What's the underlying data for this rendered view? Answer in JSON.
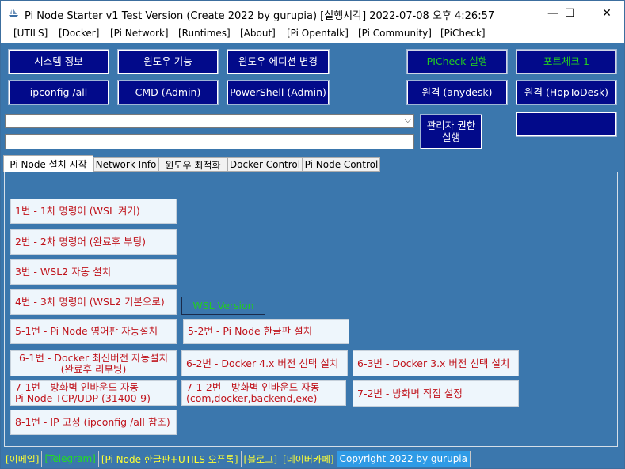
{
  "window": {
    "title": "Pi Node Starter v1 Test Version (Create 2022 by gurupia) [실행시각] 2022-07-08 오후 4:26:57",
    "controls": {
      "minimize": "—",
      "maximize": "☐",
      "close": "✕"
    }
  },
  "menu": [
    "[UTILS]",
    "[Docker]",
    "[Pi Network]",
    "[Runtimes]",
    "[About]",
    "[Pi Opentalk]",
    "[Pi Community]",
    "[PiCheck]"
  ],
  "toolbar": {
    "system_info": "시스템 정보",
    "windows_features": "윈도우 기능",
    "change_edition": "윈도우 에디션 변경",
    "picheck_run": "PICheck 실행",
    "port_check": "포트체크 1",
    "ipconfig": "ipconfig /all",
    "cmd_admin": "CMD (Admin)",
    "powershell_admin": "PowerShell (Admin)",
    "remote_anydesk": "원격 (anydesk)",
    "remote_hoptodesk": "원격 (HopToDesk)",
    "run_as_admin_line1": "관리자 권한",
    "run_as_admin_line2": "실행"
  },
  "inputs": {
    "command_combo_value": "",
    "command_text_value": ""
  },
  "tabs": [
    "Pi Node 설치 시작",
    "Network Info",
    "윈도우 최적화",
    "Docker Control",
    "Pi Node Control"
  ],
  "steps": {
    "s1": "1번 - 1차 명령어 (WSL 켜기)",
    "s2": "2번 - 2차 명령어 (완료후 부팅)",
    "s3": "3번 - WSL2 자동 설치",
    "s4": "4번 - 3차 명령어 (WSL2 기본으로)",
    "wsl_version": "WSL Version",
    "s5_1": "5-1번 - Pi Node 영어판 자동설치",
    "s5_2": "5-2번 - Pi Node 한글판 설치",
    "s6_1_line1": "6-1번 - Docker 최신버전 자동설치",
    "s6_1_line2": "(완료후 리부팅)",
    "s6_2": "6-2번 - Docker 4.x 버전 선택 설치",
    "s6_3": "6-3번 - Docker 3.x 버전 선택 설치",
    "s7_1_line1": "7-1번 - 방화벽 인바운드 자동",
    "s7_1_line2": "Pi Node TCP/UDP (31400-9)",
    "s7_1_2_line1": "7-1-2번 - 방화벽 인바운드 자동",
    "s7_1_2_line2": "(com,docker,backend,exe)",
    "s7_2": "7-2번 - 방화벽 직접 설정",
    "s8_1": "8-1번 - IP 고정 (ipconfig /all 참조)"
  },
  "status": [
    {
      "label": "[이메일]",
      "color": "#ffff33",
      "bg": "#3b77ad"
    },
    {
      "label": "[Telegram]",
      "color": "#22dd22",
      "bg": "#3b77ad"
    },
    {
      "label": "[Pi Node 한글판+UTILS 오픈톡]",
      "color": "#ffff33",
      "bg": "#3b77ad"
    },
    {
      "label": "[블로그]",
      "color": "#ffff33",
      "bg": "#3b77ad"
    },
    {
      "label": "[네이버카페]",
      "color": "#ffff33",
      "bg": "#3b77ad"
    },
    {
      "label": "Copyright 2022 by gurupia",
      "color": "#ffffff",
      "bg": "#2f9be6"
    }
  ],
  "colors": {
    "client_bg": "#3b77ad",
    "button_navy": "#020a8a",
    "step_text": "#c0141c",
    "accent_green": "#22cc22"
  }
}
